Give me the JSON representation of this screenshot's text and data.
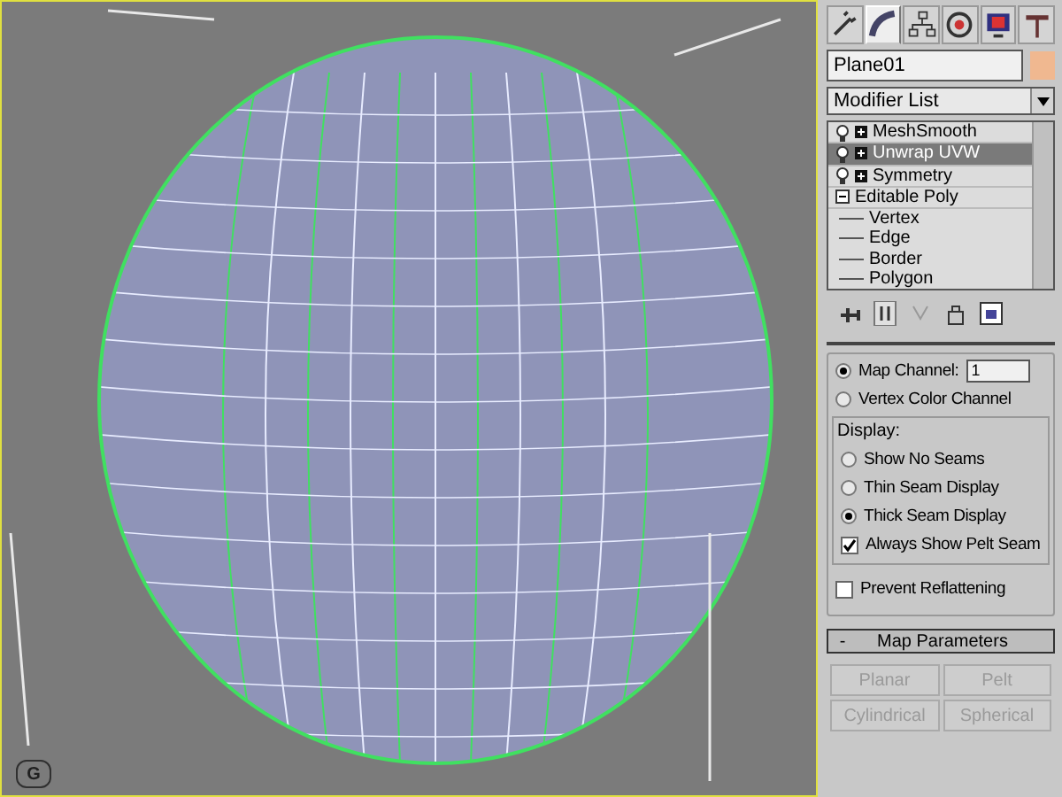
{
  "viewport": {
    "corner_label": "G"
  },
  "command_tabs": [
    {
      "kind": "create",
      "selected": false
    },
    {
      "kind": "modify",
      "selected": true
    },
    {
      "kind": "hierarchy",
      "selected": false
    },
    {
      "kind": "motion",
      "selected": false
    },
    {
      "kind": "display",
      "selected": false
    },
    {
      "kind": "utilities",
      "selected": false
    }
  ],
  "object": {
    "name": "Plane01",
    "color": "#f0b890"
  },
  "modifier_list": {
    "value": "Modifier List"
  },
  "stack": [
    {
      "kind": "modifier",
      "label": "MeshSmooth",
      "selected": false
    },
    {
      "kind": "modifier",
      "label": "Unwrap UVW",
      "selected": true
    },
    {
      "kind": "modifier",
      "label": "Symmetry",
      "selected": false
    },
    {
      "kind": "base",
      "label": "Editable Poly",
      "expanded": true,
      "selected": false,
      "children": [
        {
          "label": "Vertex"
        },
        {
          "label": "Edge"
        },
        {
          "label": "Border"
        },
        {
          "label": "Polygon"
        }
      ]
    }
  ],
  "parameters": {
    "channel": [
      {
        "label": "Map Channel:",
        "selected": true,
        "spinner": "1"
      },
      {
        "label": "Vertex Color Channel",
        "selected": false
      }
    ],
    "display": {
      "title": "Display:",
      "options": [
        {
          "label": "Show No Seams",
          "selected": false
        },
        {
          "label": "Thin Seam Display",
          "selected": false
        },
        {
          "label": "Thick Seam Display",
          "selected": true
        }
      ],
      "always_show_pelt_seam": {
        "label": "Always Show Pelt Seam",
        "checked": true
      }
    },
    "prevent_reflattening": {
      "label": "Prevent Reflattening",
      "checked": false
    }
  },
  "map_parameters": {
    "sign": "-",
    "title": "Map Parameters",
    "buttons": [
      {
        "label": "Planar",
        "disabled": true
      },
      {
        "label": "Pelt",
        "disabled": true
      },
      {
        "label": "Cylindrical",
        "disabled": true
      },
      {
        "label": "Spherical",
        "disabled": true
      }
    ]
  }
}
